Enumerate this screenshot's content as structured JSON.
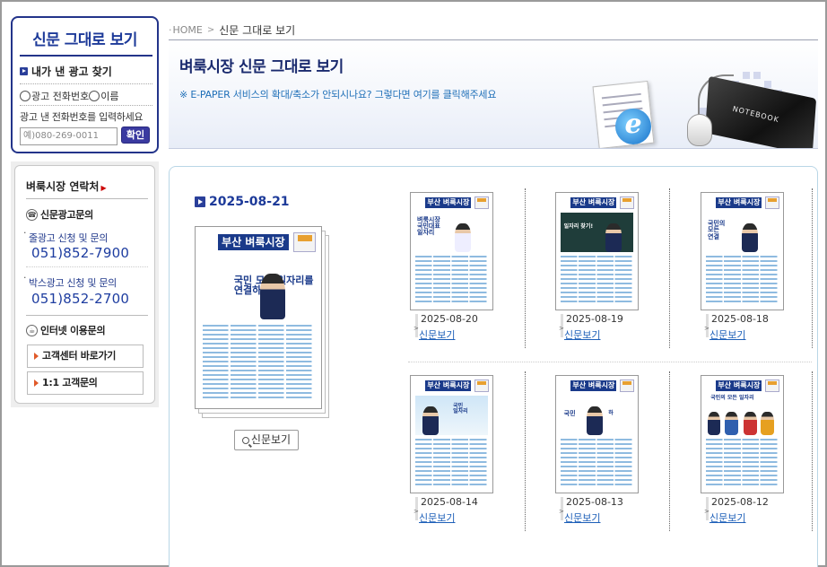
{
  "sidebar": {
    "search": {
      "title": "신문 그대로 보기",
      "find_label": "내가 낸 광고 찾기",
      "radio_phone": "광고 전화번호",
      "radio_name": "이름",
      "hint": "광고 낸 전화번호를 입력하세요",
      "input_placeholder": "예)080-269-0011",
      "confirm_label": "확인"
    },
    "contact": {
      "title": "벼룩시장 연락처",
      "section_ad": "신문광고문의",
      "line_ad_label": "줄광고 신청 및 문의",
      "line_ad_phone": "051)852-7900",
      "box_ad_label": "박스광고 신청 및 문의",
      "box_ad_phone": "051)852-2700",
      "section_internet": "인터넷 이용문의",
      "btn_customer_center": "고객센터 바로가기",
      "btn_one_on_one": "1:1 고객문의"
    }
  },
  "breadcrumb": {
    "home": "HOME",
    "current": "신문 그대로 보기"
  },
  "banner": {
    "title": "벼룩시장 신문 그대로 보기",
    "note": "※ E-PAPER 서비스의 확대/축소가 안되시나요? 그렇다면 여기를 클릭해주세요",
    "laptop_label": "NOTEBOOK"
  },
  "main": {
    "date": "2025-08-21",
    "paper_logo": "부산 벼룩시장",
    "headline": "국민 모든 일자리를 연결하다",
    "view_label": "신문보기"
  },
  "thumbnails": [
    {
      "date": "2025-08-20",
      "link": "신문보기",
      "logo": "부산 벼룩시장"
    },
    {
      "date": "2025-08-19",
      "link": "신문보기",
      "logo": "부산 벼룩시장"
    },
    {
      "date": "2025-08-18",
      "link": "신문보기",
      "logo": "부산 벼룩시장"
    },
    {
      "date": "2025-08-14",
      "link": "신문보기",
      "logo": "부산 벼룩시장"
    },
    {
      "date": "2025-08-13",
      "link": "신문보기",
      "logo": "부산 벼룩시장"
    },
    {
      "date": "2025-08-12",
      "link": "신문보기",
      "logo": "부산 벼룩시장"
    }
  ],
  "colors": {
    "brand_navy": "#1d3a99",
    "link_blue": "#1d5fb8",
    "border_light_blue": "#b9d6e6"
  }
}
